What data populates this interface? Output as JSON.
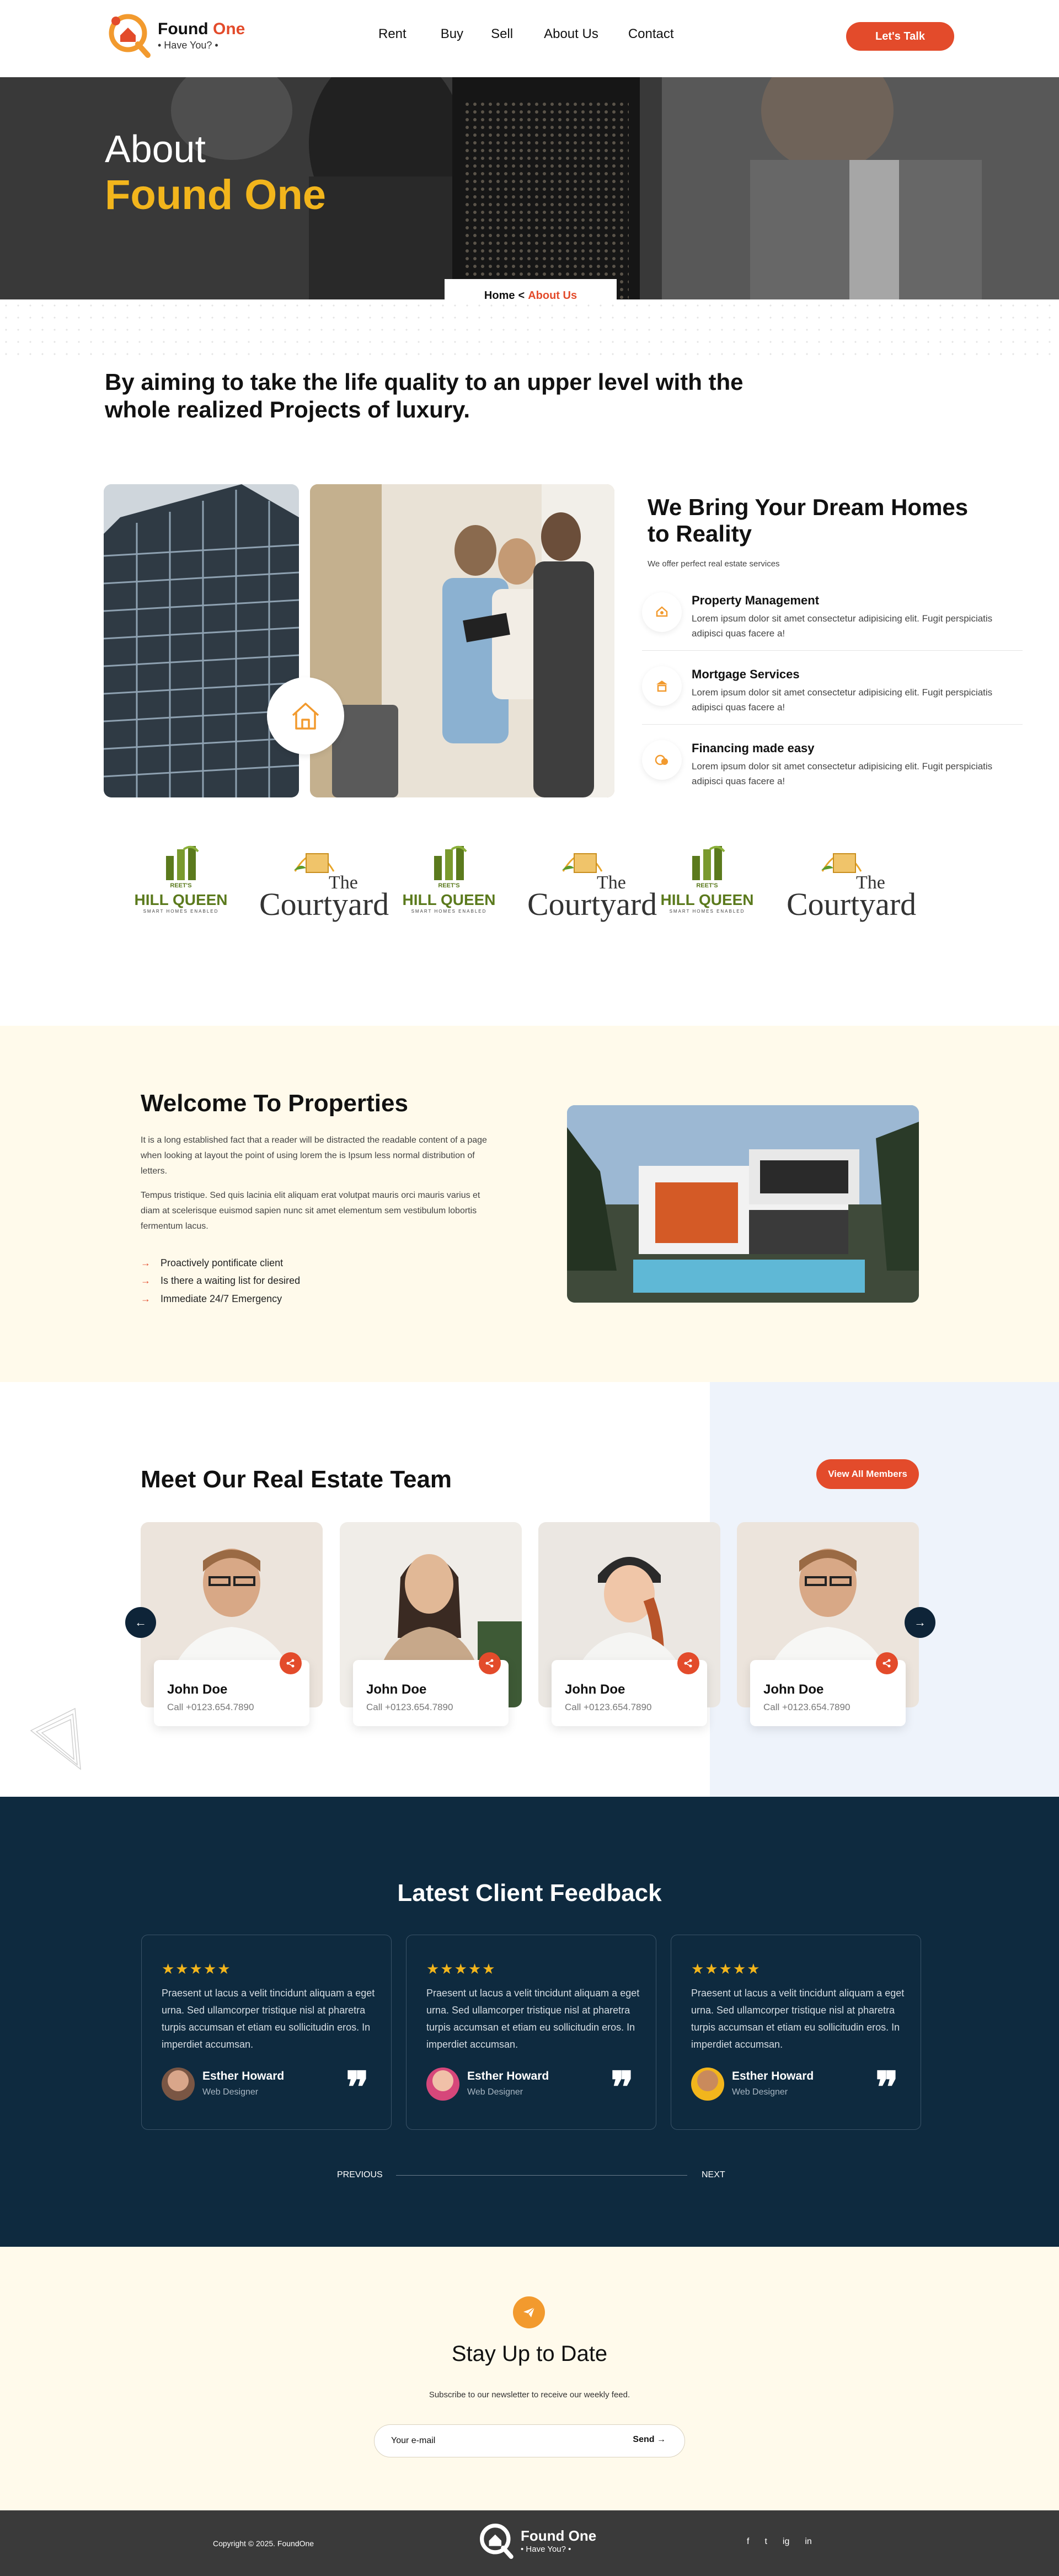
{
  "brand": {
    "name_main": "Found",
    "name_accent": "One",
    "tagline": "• Have You? •"
  },
  "nav": {
    "items": [
      {
        "label": "Rent"
      },
      {
        "label": "Buy"
      },
      {
        "label": "Sell"
      },
      {
        "label": "About Us"
      },
      {
        "label": "Contact"
      }
    ],
    "cta": "Let's Talk"
  },
  "hero": {
    "line1": "About",
    "line2": "Found One",
    "breadcrumb_home": "Home",
    "breadcrumb_sep": "<",
    "breadcrumb_current": "About Us"
  },
  "lead": "By aiming to take the life quality to an upper level with the whole realized Projects of luxury.",
  "services": {
    "title": "We Bring Your Dream Homes to Reality",
    "subtitle": "We offer perfect real estate services",
    "items": [
      {
        "title": "Property Management",
        "icon": "house-hand-icon",
        "desc": "Lorem ipsum dolor sit amet consectetur adipisicing elit. Fugit perspiciatis adipisci quas facere a!"
      },
      {
        "title": "Mortgage Services",
        "icon": "mortgage-icon",
        "desc": "Lorem ipsum dolor sit amet consectetur adipisicing elit. Fugit perspiciatis adipisci quas facere a!"
      },
      {
        "title": "Financing made easy",
        "icon": "money-icon",
        "desc": "Lorem ipsum dolor sit amet consectetur adipisicing elit. Fugit perspiciatis adipisci quas facere a!"
      }
    ]
  },
  "brands": {
    "hill_queen": {
      "top": "REET'S",
      "name_line1": "HILL",
      "name_line2": "QUEEN",
      "small": "SMART HOMES ENABLED"
    },
    "courtyard": {
      "the": "The",
      "name": "Courtyard"
    }
  },
  "welcome": {
    "title": "Welcome To Properties",
    "p1": "It is a long established fact that a reader will be distracted the readable content of a page when looking at layout the point of using lorem the is Ipsum less normal distribution of letters.",
    "p2": "Tempus tristique. Sed quis lacinia elit aliquam erat volutpat mauris orci mauris varius et diam at scelerisque euismod sapien nunc sit amet elementum sem vestibulum lobortis fermentum lacus.",
    "list": [
      "Proactively pontificate client",
      "Is there a waiting list for desired",
      "Immediate 24/7 Emergency"
    ]
  },
  "team": {
    "title": "Meet Our Real Estate Team",
    "button": "View All Members",
    "members": [
      {
        "name": "John Doe",
        "call_label": "Call",
        "phone": "+0123.654.7890"
      },
      {
        "name": "John Doe",
        "call_label": "Call",
        "phone": "+0123.654.7890"
      },
      {
        "name": "John Doe",
        "call_label": "Call",
        "phone": "+0123.654.7890"
      },
      {
        "name": "John Doe",
        "call_label": "Call",
        "phone": "+0123.654.7890"
      }
    ]
  },
  "feedback": {
    "title": "Latest Client Feedback",
    "stars": "★★★★★",
    "items": [
      {
        "text": "Praesent ut lacus a velit tincidunt aliquam a eget urna. Sed ullamcorper tristique nisl at pharetra turpis accumsan et etiam eu sollicitudin eros. In imperdiet accumsan.",
        "name": "Esther Howard",
        "role": "Web Designer"
      },
      {
        "text": "Praesent ut lacus a velit tincidunt aliquam a eget urna. Sed ullamcorper tristique nisl at pharetra turpis accumsan et etiam eu sollicitudin eros. In imperdiet accumsan.",
        "name": "Esther Howard",
        "role": "Web Designer"
      },
      {
        "text": "Praesent ut lacus a velit tincidunt aliquam a eget urna. Sed ullamcorper tristique nisl at pharetra turpis accumsan et etiam eu sollicitudin eros. In imperdiet accumsan.",
        "name": "Esther Howard",
        "role": "Web Designer"
      }
    ],
    "prev": "PREVIOUS",
    "next": "NEXT"
  },
  "newsletter": {
    "title": "Stay Up to Date",
    "subtitle": "Subscribe to our newsletter to receive our weekly feed.",
    "placeholder": "Your e-mail",
    "send": "Send"
  },
  "footer": {
    "copyright": "Copyright © 2025. FoundOne",
    "name_main": "Found One",
    "tagline": "• Have You? •",
    "socials": [
      "f",
      "t",
      "ig",
      "in"
    ]
  },
  "colors": {
    "accent": "#e34b2b",
    "gold": "#f2b51c",
    "navy": "#0e2a3f",
    "cream": "#fffaeb"
  }
}
